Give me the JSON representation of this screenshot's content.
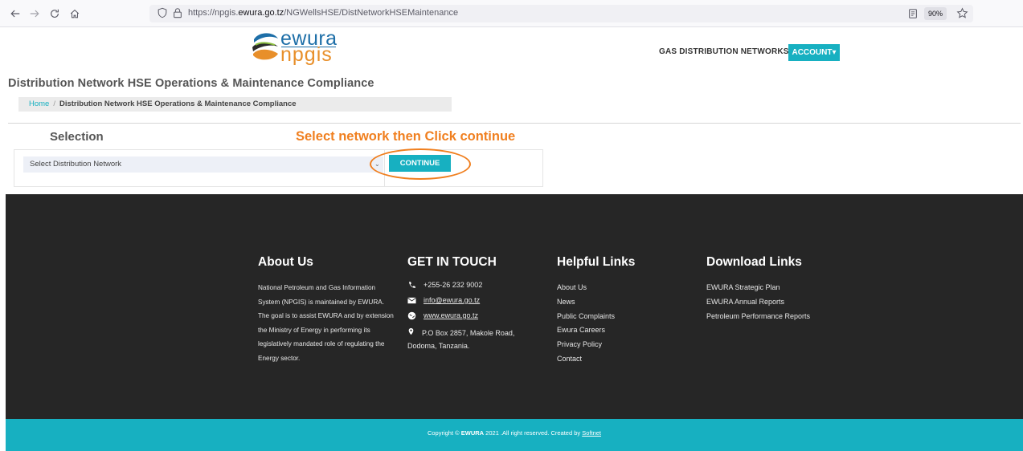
{
  "browser": {
    "url_prefix": "https://npgis.",
    "url_domain": "ewura.go.tz",
    "url_path": "/NGWellsHSE/DistNetworkHSEMaintenance",
    "zoom": "90%"
  },
  "header": {
    "logo_top": "ewura",
    "logo_bottom": "npgis",
    "nav_link": "GAS DISTRIBUTION NETWORKS",
    "account_label": "ACCOUNT▾"
  },
  "page": {
    "title": "Distribution Network HSE Operations & Maintenance Compliance",
    "breadcrumb_home": "Home",
    "breadcrumb_sep": "/",
    "breadcrumb_current": "Distribution Network HSE Operations & Maintenance Compliance",
    "selection_heading": "Selection",
    "instruction": "Select network then Click continue",
    "select_value": "Select Distribution Network",
    "continue_label": "CONTINUE"
  },
  "footer": {
    "about_heading": "About Us",
    "about_text": "National Petroleum and Gas Information System (NPGIS) is maintained by EWURA. The goal is to assist EWURA and by extension the Ministry of Energy in performing its legislatively mandated role of regulating the Energy sector.",
    "contact_heading": "GET IN TOUCH",
    "phone": "+255-26 232 9002",
    "email": "info@ewura.go.tz",
    "website": "www.ewura.go.tz",
    "address": "P.O Box 2857, Makole Road, Dodoma, Tanzania.",
    "helpful_heading": "Helpful Links",
    "helpful_links": [
      "About Us",
      "News",
      "Public Complaints",
      "Ewura Careers",
      "Privacy Policy",
      "Contact"
    ],
    "download_heading": "Download Links",
    "download_links": [
      "EWURA Strategic Plan",
      "EWURA Annual Reports",
      "Petroleum Performance Reports"
    ],
    "copyright_prefix": "Copyright © ",
    "copyright_brand": "EWURA",
    "copyright_suffix": " 2021 .All right reserved. Created by ",
    "copyright_author": "Softnet"
  },
  "colors": {
    "accent": "#17b0c1",
    "highlight": "#f07f1f",
    "footer_bg": "#262626"
  }
}
